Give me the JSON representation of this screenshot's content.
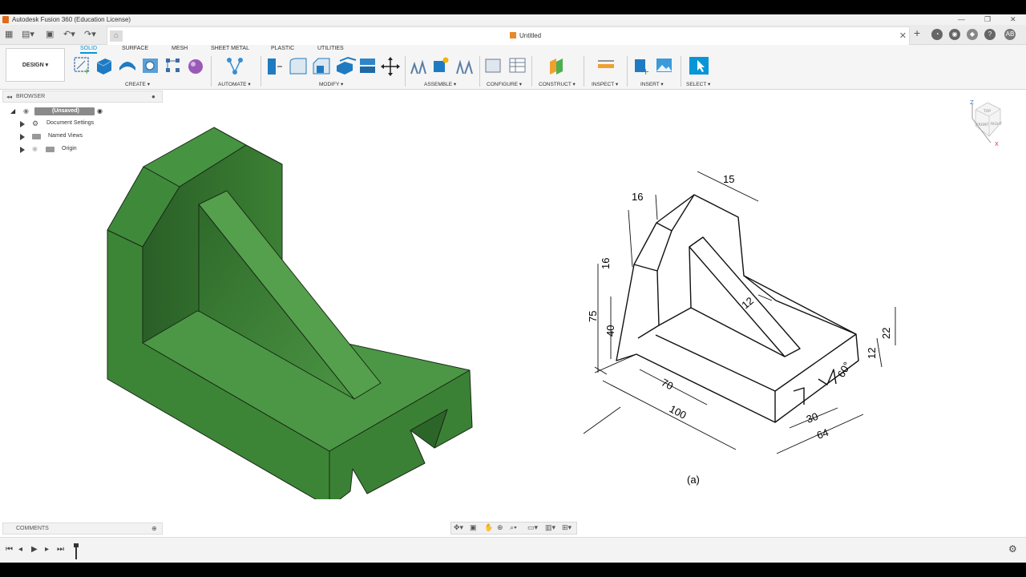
{
  "window": {
    "title": "Autodesk Fusion 360 (Education License)",
    "minimize": "—",
    "restore": "❐",
    "close": "✕"
  },
  "document": {
    "name": "Untitled",
    "close": "✕"
  },
  "user": {
    "initials": "AB"
  },
  "workspace": {
    "label": "DESIGN ▾"
  },
  "tabs": [
    {
      "label": "SOLID"
    },
    {
      "label": "SURFACE"
    },
    {
      "label": "MESH"
    },
    {
      "label": "SHEET METAL"
    },
    {
      "label": "PLASTIC"
    },
    {
      "label": "UTILITIES"
    }
  ],
  "groups": [
    {
      "label": "CREATE ▾"
    },
    {
      "label": "AUTOMATE ▾"
    },
    {
      "label": "MODIFY ▾"
    },
    {
      "label": "ASSEMBLE ▾"
    },
    {
      "label": "CONFIGURE ▾"
    },
    {
      "label": "CONSTRUCT ▾"
    },
    {
      "label": "INSPECT ▾"
    },
    {
      "label": "INSERT ▾"
    },
    {
      "label": "SELECT ▾"
    }
  ],
  "browser": {
    "title": "BROWSER",
    "root": "(Unsaved)",
    "items": [
      {
        "label": "Document Settings"
      },
      {
        "label": "Named Views"
      },
      {
        "label": "Origin"
      }
    ]
  },
  "comments": {
    "title": "COMMENTS"
  },
  "viewcube": {
    "axis_z": "Z",
    "axis_x": "X",
    "top": "TOP",
    "front": "FRONT",
    "right": "RIGHT"
  },
  "drawing": {
    "caption": "(a)",
    "dims": {
      "d15": "15",
      "d16top": "16",
      "d16side": "16",
      "d75": "75",
      "d40": "40",
      "d12slot": "12",
      "d22": "22",
      "d12right": "12",
      "d60": "60°",
      "d70": "70",
      "d100": "100",
      "d30": "30",
      "d64": "64"
    }
  },
  "colors": {
    "accent": "#0696d7",
    "model_green": "#3f8a3a",
    "model_edge": "#1a2a18"
  }
}
